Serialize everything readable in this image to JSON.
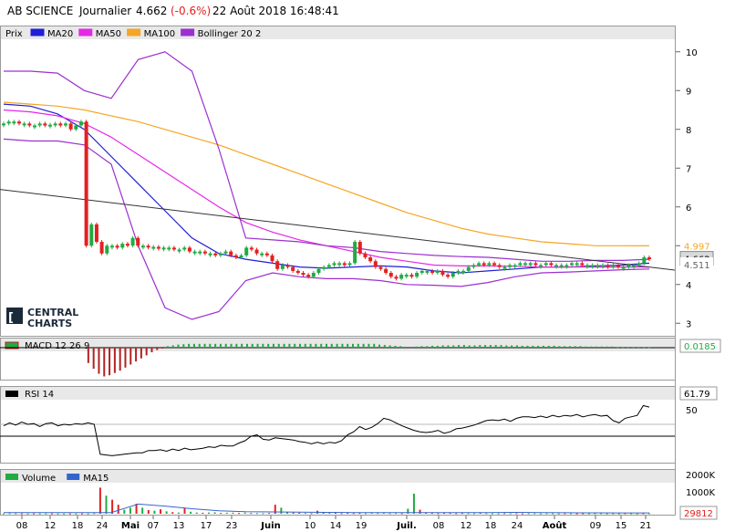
{
  "header": {
    "symbol": "AB SCIENCE",
    "period": "Journalier",
    "price": "4.662",
    "change": "(-0.6%)",
    "datetime": "22 Août 2018 16:48:41"
  },
  "watermark": {
    "line1": "CENTRAL",
    "line2": "CHARTS"
  },
  "legend_main": [
    {
      "label": "Prix",
      "color": "#ffffff",
      "border": "#888888"
    },
    {
      "label": "MA20",
      "color": "#1f1fd6"
    },
    {
      "label": "MA50",
      "color": "#e628e6"
    },
    {
      "label": "MA100",
      "color": "#f5a623"
    },
    {
      "label": "Bollinger 20 2",
      "color": "#9b30d0"
    }
  ],
  "legend_macd": {
    "label": "MACD 12 26 9"
  },
  "legend_rsi": {
    "label": "RSI 14"
  },
  "legend_volume": [
    {
      "label": "Volume",
      "color": "#22aa44"
    },
    {
      "label": "MA15",
      "color": "#3366cc"
    }
  ],
  "price_axis": [
    "10",
    "9",
    "8",
    "7",
    "6",
    "5",
    "4",
    "3"
  ],
  "price_tags": [
    {
      "label": "4.997",
      "color": "#f5a623",
      "bg": "#ffffff",
      "value": 4.997
    },
    {
      "label": "4.662",
      "color": "#000000",
      "bg": "#d9d9d9",
      "value": 4.662
    },
    {
      "label": "4.511",
      "color": "#666666",
      "bg": "#ffffff",
      "value": 4.511
    }
  ],
  "macd_tag": "0.0185",
  "rsi_tag": "61.79",
  "rsi_axis": "50",
  "volume_axis": [
    "2000K",
    "1000K"
  ],
  "volume_tag": "29812",
  "colors": {
    "up": "#22aa44",
    "down": "#e32020",
    "macd_up": "#22aa44",
    "macd_down": "#b22222"
  },
  "chart_data": {
    "type": "line",
    "title": "AB SCIENCE",
    "x_ticks": [
      "08",
      "12",
      "18",
      "24",
      "Mai",
      "07",
      "13",
      "17",
      "23",
      "Juin",
      "10",
      "14",
      "19",
      "Juil.",
      "08",
      "12",
      "18",
      "24",
      "Août",
      "09",
      "15",
      "21"
    ],
    "ylim": [
      2.7,
      10.3
    ],
    "candles": [
      8.15,
      8.2,
      8.2,
      8.15,
      8.15,
      8.1,
      8.1,
      8.15,
      8.1,
      8.12,
      8.15,
      8.1,
      8.15,
      8.0,
      8.1,
      8.2,
      5.0,
      5.55,
      5.1,
      4.8,
      5.0,
      5.0,
      4.95,
      5.05,
      5.0,
      5.2,
      5.0,
      5.0,
      4.97,
      4.97,
      4.95,
      4.95,
      4.95,
      4.9,
      4.9,
      4.95,
      4.85,
      4.85,
      4.85,
      4.8,
      4.8,
      4.75,
      4.8,
      4.85,
      4.75,
      4.7,
      4.75,
      4.95,
      4.9,
      4.8,
      4.8,
      4.75,
      4.6,
      4.4,
      4.5,
      4.45,
      4.35,
      4.3,
      4.25,
      4.2,
      4.3,
      4.4,
      4.45,
      4.5,
      4.55,
      4.55,
      4.5,
      4.55,
      5.1,
      4.8,
      4.7,
      4.6,
      4.45,
      4.4,
      4.3,
      4.2,
      4.15,
      4.25,
      4.25,
      4.2,
      4.3,
      4.35,
      4.35,
      4.3,
      4.35,
      4.25,
      4.2,
      4.3,
      4.35,
      4.35,
      4.45,
      4.5,
      4.55,
      4.5,
      4.55,
      4.5,
      4.45,
      4.45,
      4.5,
      4.5,
      4.55,
      4.55,
      4.55,
      4.5,
      4.5,
      4.55,
      4.5,
      4.5,
      4.5,
      4.5,
      4.55,
      4.55,
      4.5,
      4.5,
      4.5,
      4.5,
      4.5,
      4.45,
      4.5,
      4.45,
      4.45,
      4.5,
      4.5,
      4.55,
      4.7,
      4.662
    ],
    "series": [
      {
        "name": "MA20",
        "values": [
          8.65,
          8.6,
          8.4,
          8.0,
          7.3,
          6.6,
          5.9,
          5.2,
          4.8,
          4.65,
          4.55,
          4.45,
          4.42,
          4.45,
          4.48,
          4.45,
          4.35,
          4.3,
          4.35,
          4.4,
          4.45,
          4.45,
          4.48,
          4.5,
          4.55
        ]
      },
      {
        "name": "MA50",
        "values": [
          8.5,
          8.45,
          8.35,
          8.15,
          7.8,
          7.35,
          6.9,
          6.45,
          6.0,
          5.6,
          5.35,
          5.15,
          5.0,
          4.85,
          4.7,
          4.6,
          4.5,
          4.48,
          4.48,
          4.47,
          4.45,
          4.45,
          4.45,
          4.45,
          4.45
        ]
      },
      {
        "name": "MA100",
        "values": [
          8.7,
          8.65,
          8.6,
          8.5,
          8.35,
          8.2,
          8.0,
          7.8,
          7.6,
          7.35,
          7.1,
          6.85,
          6.6,
          6.35,
          6.1,
          5.85,
          5.65,
          5.45,
          5.3,
          5.2,
          5.1,
          5.05,
          5.0,
          5.0,
          4.997
        ]
      },
      {
        "name": "Bollinger 20 2",
        "values": [
          9.5,
          9.5,
          9.45,
          9.0,
          8.8,
          9.8,
          10.0,
          9.5,
          7.5,
          5.2,
          5.15,
          5.1,
          5.0,
          4.95,
          4.85,
          4.8,
          4.75,
          4.72,
          4.7,
          4.65,
          4.6,
          4.6,
          4.62,
          4.62,
          4.65
        ]
      },
      {
        "name": "Bollinger 20 2",
        "values": [
          7.75,
          7.7,
          7.7,
          7.6,
          7.1,
          5.0,
          3.4,
          3.1,
          3.3,
          4.1,
          4.3,
          4.2,
          4.15,
          4.15,
          4.1,
          4.0,
          3.98,
          3.95,
          4.05,
          4.2,
          4.3,
          4.32,
          4.35,
          4.38,
          4.4
        ]
      }
    ],
    "trendline": [
      6.45,
      4.45
    ],
    "macd": [
      0,
      0,
      0,
      0,
      0,
      0,
      0,
      0,
      0,
      0,
      0,
      0,
      0,
      0,
      0,
      0,
      -0.4,
      -0.55,
      -0.68,
      -0.75,
      -0.72,
      -0.66,
      -0.6,
      -0.52,
      -0.44,
      -0.36,
      -0.28,
      -0.2,
      -0.12,
      -0.06,
      -0.02,
      0.04,
      0.06,
      0.08,
      0.09,
      0.1,
      0.1,
      0.1,
      0.1,
      0.1,
      0.1,
      0.1,
      0.1,
      0.1,
      0.1,
      0.1,
      0.1,
      0.1,
      0.1,
      0.1,
      0.1,
      0.1,
      0.1,
      0.1,
      0.1,
      0.1,
      0.1,
      0.1,
      0.1,
      0.1,
      0.1,
      0.1,
      0.1,
      0.1,
      0.1,
      0.1,
      0.1,
      0.1,
      0.1,
      0.1,
      0.1,
      0.08,
      0.07,
      0.06,
      0.05,
      0.04,
      0,
      0,
      0.03,
      0.04,
      0.04,
      0.05,
      0.05,
      0.06,
      0.06,
      0.06,
      0.07,
      0.07,
      0.06,
      0.06,
      0.07,
      0.07,
      0.07,
      0.07,
      0.07,
      0.06,
      0.06,
      0.06,
      0.05,
      0.05,
      0.05,
      0.05,
      0.05,
      0.05,
      0.05,
      0.04,
      0.04,
      0.04,
      0.04,
      0.04,
      0.03,
      0.03,
      0.03,
      0.03,
      0.03,
      0.03,
      0.02,
      0.02,
      0.02,
      0.02,
      0.02,
      0.02,
      0.0185
    ],
    "rsi": [
      48,
      52,
      49,
      53,
      50,
      51,
      47,
      51,
      52,
      48,
      50,
      49,
      51,
      50,
      52,
      50,
      10,
      9,
      8,
      9,
      10,
      11,
      12,
      12,
      15,
      15,
      16,
      14,
      17,
      15,
      18,
      16,
      17,
      18,
      20,
      19,
      22,
      21,
      21,
      25,
      28,
      34,
      36,
      30,
      29,
      32,
      31,
      30,
      29,
      27,
      26,
      24,
      26,
      24,
      26,
      25,
      28,
      36,
      40,
      47,
      43,
      46,
      51,
      58,
      56,
      52,
      48,
      45,
      42,
      40,
      39,
      40,
      42,
      38,
      40,
      44,
      45,
      47,
      49,
      52,
      55,
      56,
      55,
      57,
      54,
      58,
      60,
      60,
      59,
      61,
      59,
      62,
      60,
      62,
      61,
      63,
      60,
      62,
      63,
      61,
      62,
      55,
      52,
      58,
      60,
      62,
      75,
      73
    ],
    "volume": [
      20,
      30,
      25,
      20,
      15,
      20,
      18,
      22,
      20,
      15,
      12,
      18,
      15,
      20,
      16,
      30,
      1300,
      900,
      700,
      450,
      200,
      300,
      500,
      300,
      180,
      150,
      220,
      120,
      80,
      60,
      300,
      100,
      60,
      50,
      60,
      70,
      40,
      50,
      55,
      40,
      60,
      40,
      35,
      30,
      40,
      450,
      300,
      80,
      60,
      50,
      40,
      30,
      150,
      60,
      40,
      50,
      30,
      40,
      35,
      40,
      30,
      50,
      40,
      50,
      30,
      40,
      30,
      250,
      1000,
      200,
      60,
      40,
      30,
      60,
      40,
      30,
      40,
      30,
      30,
      50,
      30,
      25,
      20,
      30,
      25,
      30,
      20,
      25,
      30,
      20,
      30,
      25,
      20,
      25,
      30,
      20,
      25,
      20,
      25,
      30,
      20,
      25,
      20,
      30,
      25,
      20,
      30,
      30
    ],
    "volume_ma15": [
      60,
      60,
      60,
      60,
      60,
      480,
      380,
      250,
      150,
      100,
      90,
      80,
      70,
      60,
      55,
      55,
      55,
      55,
      60,
      70,
      60,
      50,
      45,
      40,
      40
    ],
    "volume_ylim": [
      0,
      2000
    ]
  }
}
